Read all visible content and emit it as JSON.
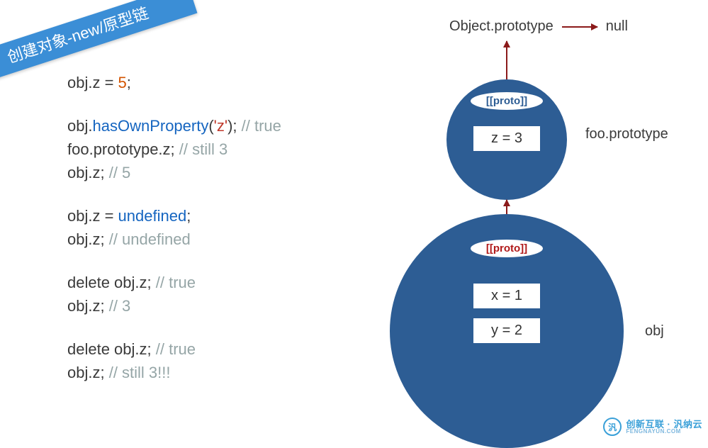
{
  "ribbon": "创建对象-new/原型链",
  "code": {
    "l1_a": "obj.z = ",
    "l1_b": "5",
    "l1_c": ";",
    "l2_a": "obj.",
    "l2_b": "hasOwnProperty",
    "l2_c": "(",
    "l2_d": "'z'",
    "l2_e": "); ",
    "l2_f": "// true",
    "l3_a": "foo.prototype.z; ",
    "l3_b": "// still 3",
    "l4_a": "obj.z; ",
    "l4_b": "// 5",
    "l5_a": "obj.z = ",
    "l5_b": "undefined",
    "l5_c": ";",
    "l6_a": "obj.z; ",
    "l6_b": "// undefined",
    "l7_a": "delete obj.z; ",
    "l7_b": "// true",
    "l8_a": "obj.z; ",
    "l8_b": "// 3",
    "l9_a": "delete obj.z; ",
    "l9_b": "// true",
    "l10_a": "obj.z; ",
    "l10_b": "// still 3!!!"
  },
  "diagram": {
    "top_left": "Object.prototype",
    "top_right": "null",
    "foo_label": "foo.prototype",
    "obj_label": "obj",
    "proto_text": "[[proto]]",
    "foo_box": "z = 3",
    "obj_box1": "x = 1",
    "obj_box2": "y = 2"
  },
  "watermark": {
    "icon": "汎",
    "text1": "创新互联",
    "text2": "汎纳云",
    "sub": "FENGNAYUN.COM"
  }
}
